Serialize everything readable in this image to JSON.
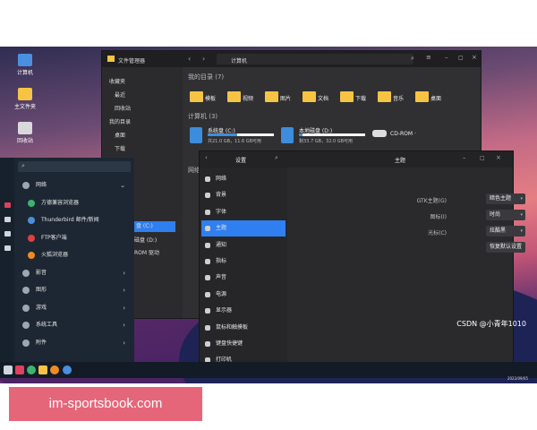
{
  "desktop": {
    "icons": [
      {
        "label": "计算机",
        "icon": "computer-icon",
        "color": "#4a90e2"
      },
      {
        "label": "主文件夹",
        "icon": "home-folder-icon",
        "color": "#f6c343"
      },
      {
        "label": "回收站",
        "icon": "trash-icon",
        "color": "#d9d9d9"
      }
    ]
  },
  "file_manager": {
    "app_title": "文件管理器",
    "path": "计算机",
    "sidebar": {
      "sections": [
        {
          "head": "收藏夹",
          "items": [
            "最近",
            "回收站"
          ]
        },
        {
          "head": "我的目录",
          "items": [
            "桌面",
            "下载"
          ]
        }
      ],
      "partial_items": [
        "盘 (C:)",
        "磁盘 (D:)",
        "ROM 驱动"
      ]
    },
    "my_dirs_title": "我的目录 (7)",
    "folders": [
      "模板",
      "视频",
      "图片",
      "文档",
      "下载",
      "音乐",
      "桌面"
    ],
    "computer_title": "计算机 (3)",
    "drives": [
      {
        "name": "系统盘 (C:)",
        "stats": "共21.0 GB，11.6 GB可用",
        "used_fraction": 0.45
      },
      {
        "name": "本地磁盘 (D:)",
        "stats": "剩33.7 GB，32.0 GB可用",
        "used_fraction": 0.05
      }
    ],
    "cdrom": "CD-ROM ·",
    "network_title": "网络"
  },
  "settings": {
    "title": "设置",
    "page_title": "主题",
    "nav": [
      "网络",
      "背景",
      "字体",
      "主题",
      "通知",
      "指标",
      "声音",
      "电源",
      "显示器",
      "鼠标和触摸板",
      "键盘快捷键",
      "打印机"
    ],
    "active_index": 3,
    "options": [
      {
        "label": "GTK主题(G)",
        "value": "暗色主题"
      },
      {
        "label": "图标(I)",
        "value": "时尚"
      },
      {
        "label": "光标(C)",
        "value": "炫酷黑"
      }
    ],
    "reset_label": "恢复默认设置"
  },
  "start_menu": {
    "items": [
      {
        "label": "网络",
        "icon": "globe-icon",
        "arrow": "⌄",
        "color": "#9aa7b5"
      },
      {
        "label": "方德兼容浏览器",
        "icon": "browser-icon",
        "arrow": "",
        "color": "#3cb371",
        "sub": true
      },
      {
        "label": "Thunderbird 邮件/新闻",
        "icon": "mail-icon",
        "arrow": "",
        "color": "#4a8fe0",
        "sub": true
      },
      {
        "label": "FTP客户端",
        "icon": "ftp-icon",
        "arrow": "",
        "color": "#e04040",
        "sub": true
      },
      {
        "label": "火狐浏览器",
        "icon": "firefox-icon",
        "arrow": "",
        "color": "#f08a24",
        "sub": true
      },
      {
        "label": "影音",
        "icon": "media-icon",
        "arrow": "›",
        "color": "#9aa7b5"
      },
      {
        "label": "图形",
        "icon": "graphics-icon",
        "arrow": "›",
        "color": "#9aa7b5"
      },
      {
        "label": "游戏",
        "icon": "game-icon",
        "arrow": "›",
        "color": "#9aa7b5"
      },
      {
        "label": "系统工具",
        "icon": "tools-icon",
        "arrow": "›",
        "color": "#9aa7b5"
      },
      {
        "label": "附件",
        "icon": "attachment-icon",
        "arrow": "›",
        "color": "#9aa7b5"
      }
    ]
  },
  "taskbar": {
    "date": "2022/09/05"
  },
  "watermark": "CSDN @小青年1010",
  "brand": "im-sportsbook.com"
}
